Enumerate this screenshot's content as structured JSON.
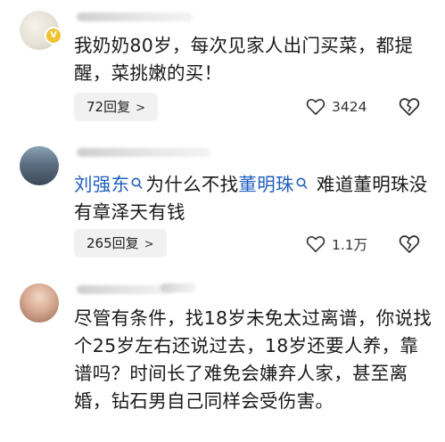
{
  "comments": [
    {
      "text": "我奶奶80岁，每次见家人出门买菜，都提醒，菜挑嫩的买！",
      "badge": "V",
      "reply_label": "72回复",
      "like_count": "3424"
    },
    {
      "mention_1": "刘强东",
      "text_mid": "为什么不找",
      "mention_2": "董明珠",
      "text_end": "难道董明珠没有章泽天有钱",
      "reply_label": "265回复",
      "like_count": "1.1万"
    },
    {
      "text": "尽管有条件，找18岁未免太过离谱，你说找个25岁左右还说过去，18岁还要人养，靠谱吗？时间长了难免会嫌弃人家，甚至离婚，钻石男自己同样会受伤害。"
    }
  ],
  "icons": {
    "heart": "heart-outline-icon",
    "broken_heart": "broken-heart-icon",
    "chevron": "chevron-right-icon",
    "mention": "mention-icon"
  },
  "colors": {
    "mention": "#1f5fbf",
    "reply_bg": "#f1f1f1",
    "badge": "#f1c232"
  }
}
